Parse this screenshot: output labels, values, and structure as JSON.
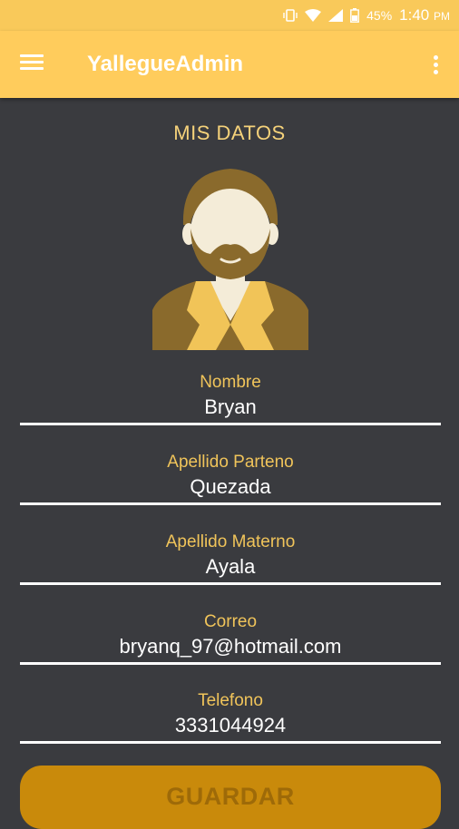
{
  "status_bar": {
    "battery_percent": "45%",
    "time": "1:40",
    "time_suffix": "PM",
    "icons": [
      "vibrate-icon",
      "wifi-icon",
      "signal-icon",
      "battery-icon"
    ]
  },
  "app_bar": {
    "title": "YallegueAdmin",
    "background": "#ffcc5c",
    "icons": [
      "menu-icon",
      "more-vertical-icon"
    ]
  },
  "main": {
    "section_title": "MIS DATOS",
    "avatar_icon": "user-avatar-icon",
    "fields": [
      {
        "label": "Nombre",
        "value": "Bryan"
      },
      {
        "label": "Apellido Parteno",
        "value": "Quezada"
      },
      {
        "label": "Apellido Materno",
        "value": "Ayala"
      },
      {
        "label": "Correo",
        "value": "bryanq_97@hotmail.com"
      },
      {
        "label": "Telefono",
        "value": "3331044924"
      }
    ],
    "save_label": "GUARDAR"
  },
  "colors": {
    "background": "#3a3b3f",
    "accent": "#f0c45a",
    "button": "#c98a0b"
  }
}
